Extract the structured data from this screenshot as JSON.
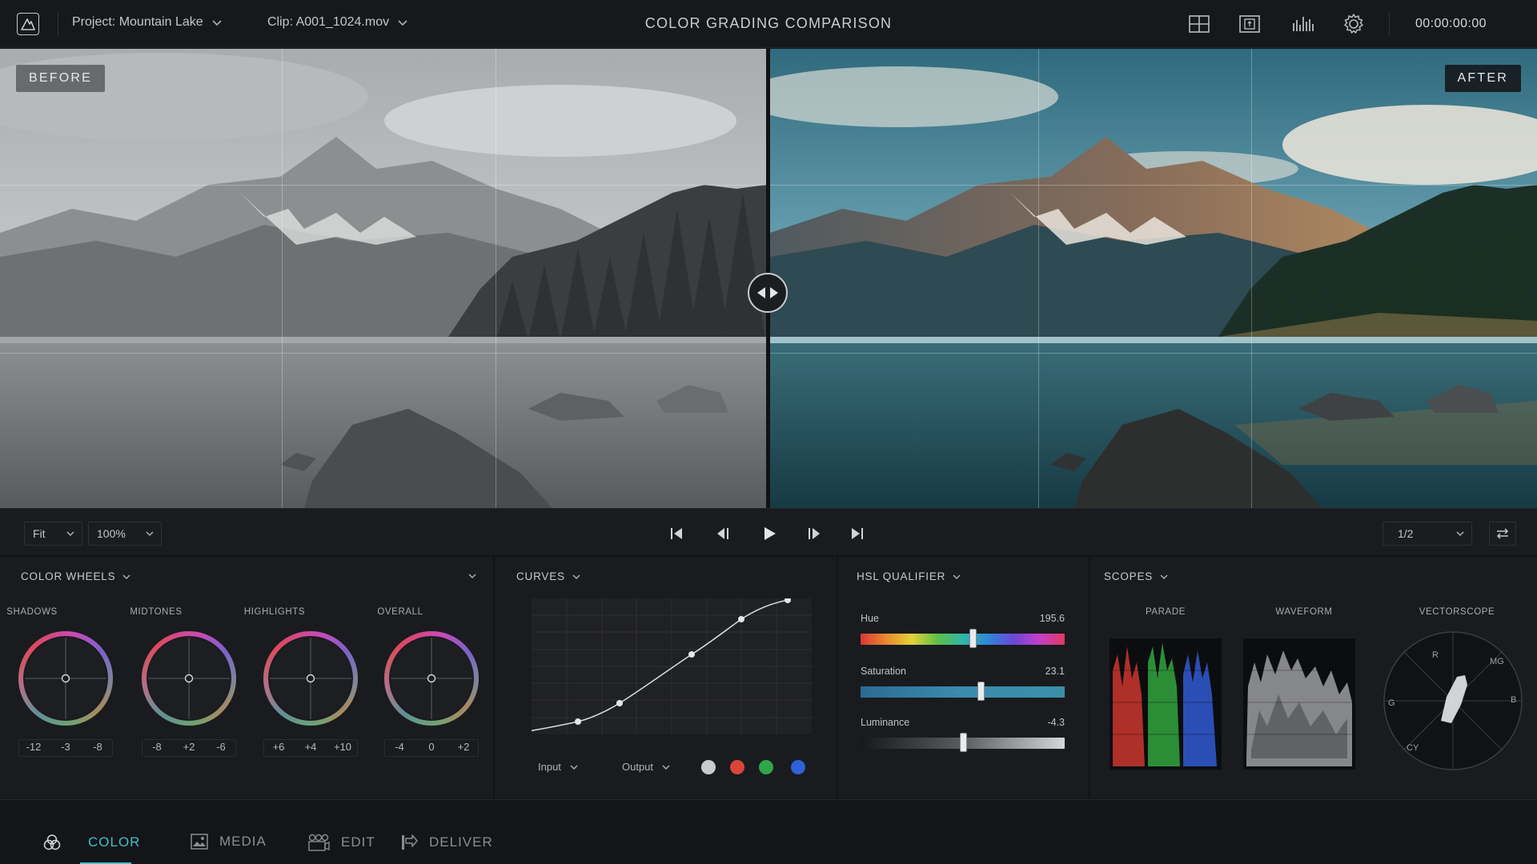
{
  "topbar": {
    "project": "Project: Mountain Lake",
    "clip": "Clip: A001_1024.mov",
    "title": "COLOR GRADING COMPARISON",
    "timecode": "00:00:00:00",
    "icons": [
      "layout-grid-icon",
      "monitor-icon",
      "audio-meter-icon",
      "settings-gear-icon"
    ]
  },
  "viewer": {
    "before_label": "BEFORE",
    "after_label": "AFTER"
  },
  "transport": {
    "fit": "Fit",
    "zoom": "100%",
    "page": "1/2"
  },
  "color_wheels": {
    "title": "COLOR WHEELS",
    "wheels": [
      {
        "label": "SHADOWS",
        "values": [
          "-12",
          "-3",
          "-8"
        ]
      },
      {
        "label": "MIDTONES",
        "values": [
          "-8",
          "+2",
          "-6"
        ]
      },
      {
        "label": "HIGHLIGHTS",
        "values": [
          "+6",
          "+4",
          "+10"
        ]
      },
      {
        "label": "OVERALL",
        "values": [
          "-4",
          "0",
          "+2"
        ]
      }
    ]
  },
  "curves": {
    "title": "CURVES",
    "input_label": "Input",
    "output_label": "Output",
    "channels": [
      {
        "name": "luma",
        "color": "#c9cbcf"
      },
      {
        "name": "red",
        "color": "#d9453a"
      },
      {
        "name": "green",
        "color": "#2fa64a"
      },
      {
        "name": "blue",
        "color": "#2e62d8"
      }
    ]
  },
  "hsl": {
    "title": "HSL QUALIFIER",
    "rows": [
      {
        "label": "Hue",
        "value": "195.6",
        "level": 0.55
      },
      {
        "label": "Saturation",
        "value": "23.1",
        "level": 0.59
      },
      {
        "label": "Luminance",
        "value": "-4.3",
        "level": 0.5
      }
    ]
  },
  "scopes": {
    "title": "SCOPES",
    "items": [
      "PARADE",
      "WAVEFORM",
      "VECTORSCOPE"
    ],
    "vector_labels": [
      "R",
      "MG",
      "B",
      "CY",
      "G"
    ]
  },
  "bottom_tabs": [
    {
      "label": "COLOR",
      "active": true
    },
    {
      "label": "MEDIA",
      "active": false
    },
    {
      "label": "EDIT",
      "active": false
    },
    {
      "label": "DELIVER",
      "active": false
    }
  ],
  "accent_color": "#3fc1c9"
}
